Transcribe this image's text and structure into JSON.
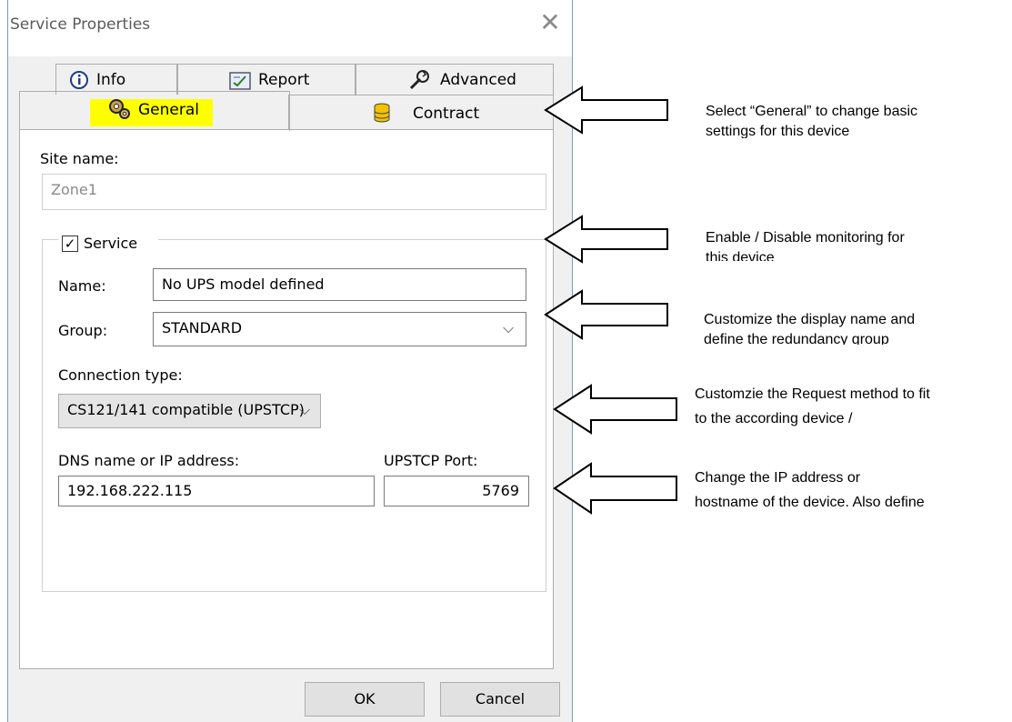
{
  "window": {
    "title": "Service Properties",
    "close_glyph": "✕"
  },
  "tabs": {
    "row1": [
      {
        "label": "Info",
        "icon": "info-icon"
      },
      {
        "label": "Report",
        "icon": "report-icon"
      },
      {
        "label": "Advanced",
        "icon": "wrench-icon"
      }
    ],
    "row2": [
      {
        "label": "General",
        "icon": "gears-icon",
        "selected": true,
        "highlight": "#ffff00"
      },
      {
        "label": "Contract",
        "icon": "database-icon"
      }
    ]
  },
  "general": {
    "site_name_label": "Site name:",
    "site_name_value": "Zone1",
    "service_checkbox_label": "Service",
    "service_checked": true,
    "name_label": "Name:",
    "name_value": "No UPS model defined",
    "group_label": "Group:",
    "group_value": "STANDARD",
    "connection_label": "Connection type:",
    "connection_value": "CS121/141 compatible (UPSTCP)",
    "dns_label": "DNS name or IP address:",
    "dns_value": "192.168.222.115",
    "port_label": "UPSTCP Port:",
    "port_value": "5769"
  },
  "buttons": {
    "ok": "OK",
    "cancel": "Cancel"
  },
  "annotations": [
    {
      "line1": "Select “General” to change basic",
      "line2": "settings for this device"
    },
    {
      "line1": "Enable / Disable monitoring for",
      "line2": "this device"
    },
    {
      "line1": "Customize the display name and",
      "line2": "define the redundancy group"
    },
    {
      "line1": "Customzie the Request method to fit",
      "line2": "to the according device /"
    },
    {
      "line1": "Change the IP address or",
      "line2": "hostname of the device. Also define"
    }
  ]
}
